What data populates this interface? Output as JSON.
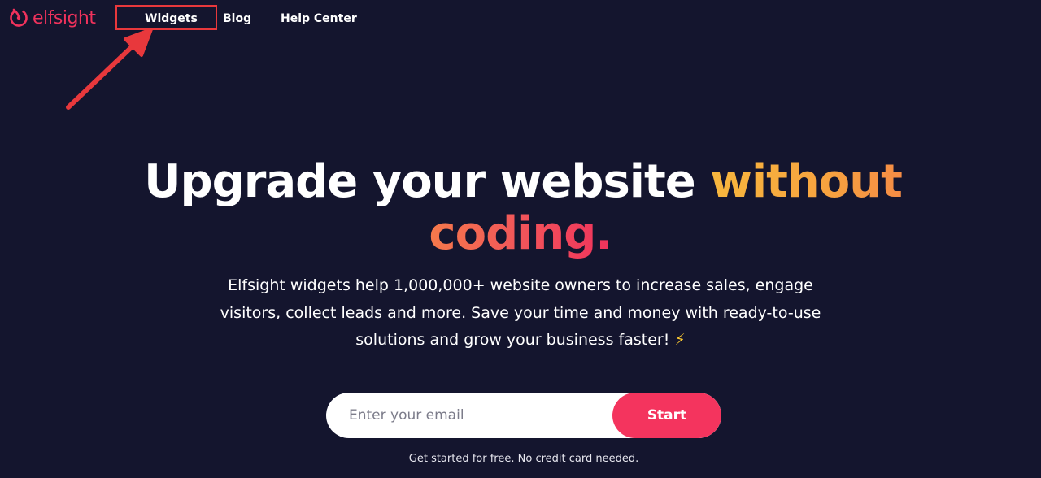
{
  "header": {
    "logo": {
      "text": "elfsight",
      "icon": "elfsight-logo-icon",
      "color": "#f0325c"
    },
    "nav": [
      {
        "label": "Widgets",
        "highlighted": true
      },
      {
        "label": "Blog"
      },
      {
        "label": "Help Center"
      }
    ]
  },
  "annotation": {
    "box_color": "#e8383c",
    "arrow_color": "#e8383c",
    "target": "Widgets"
  },
  "hero": {
    "headline": {
      "part1": "Upgrade your website ",
      "part2": "without",
      "part3": "coding."
    },
    "subtitle": "Elfsight widgets help 1,000,000+ website owners to increase sales, engage visitors, collect leads and more. Save your time and money with ready-to-use solutions and grow your business faster! ",
    "subtitle_emoji": "⚡",
    "form": {
      "email_placeholder": "Enter your email",
      "email_value": "",
      "button_label": "Start"
    },
    "footnote": "Get started for free. No credit card needed."
  },
  "colors": {
    "background": "#14152e",
    "accent": "#f4345e",
    "headline_orange": "#f7b73e",
    "headline_coral": "#f2555a"
  }
}
